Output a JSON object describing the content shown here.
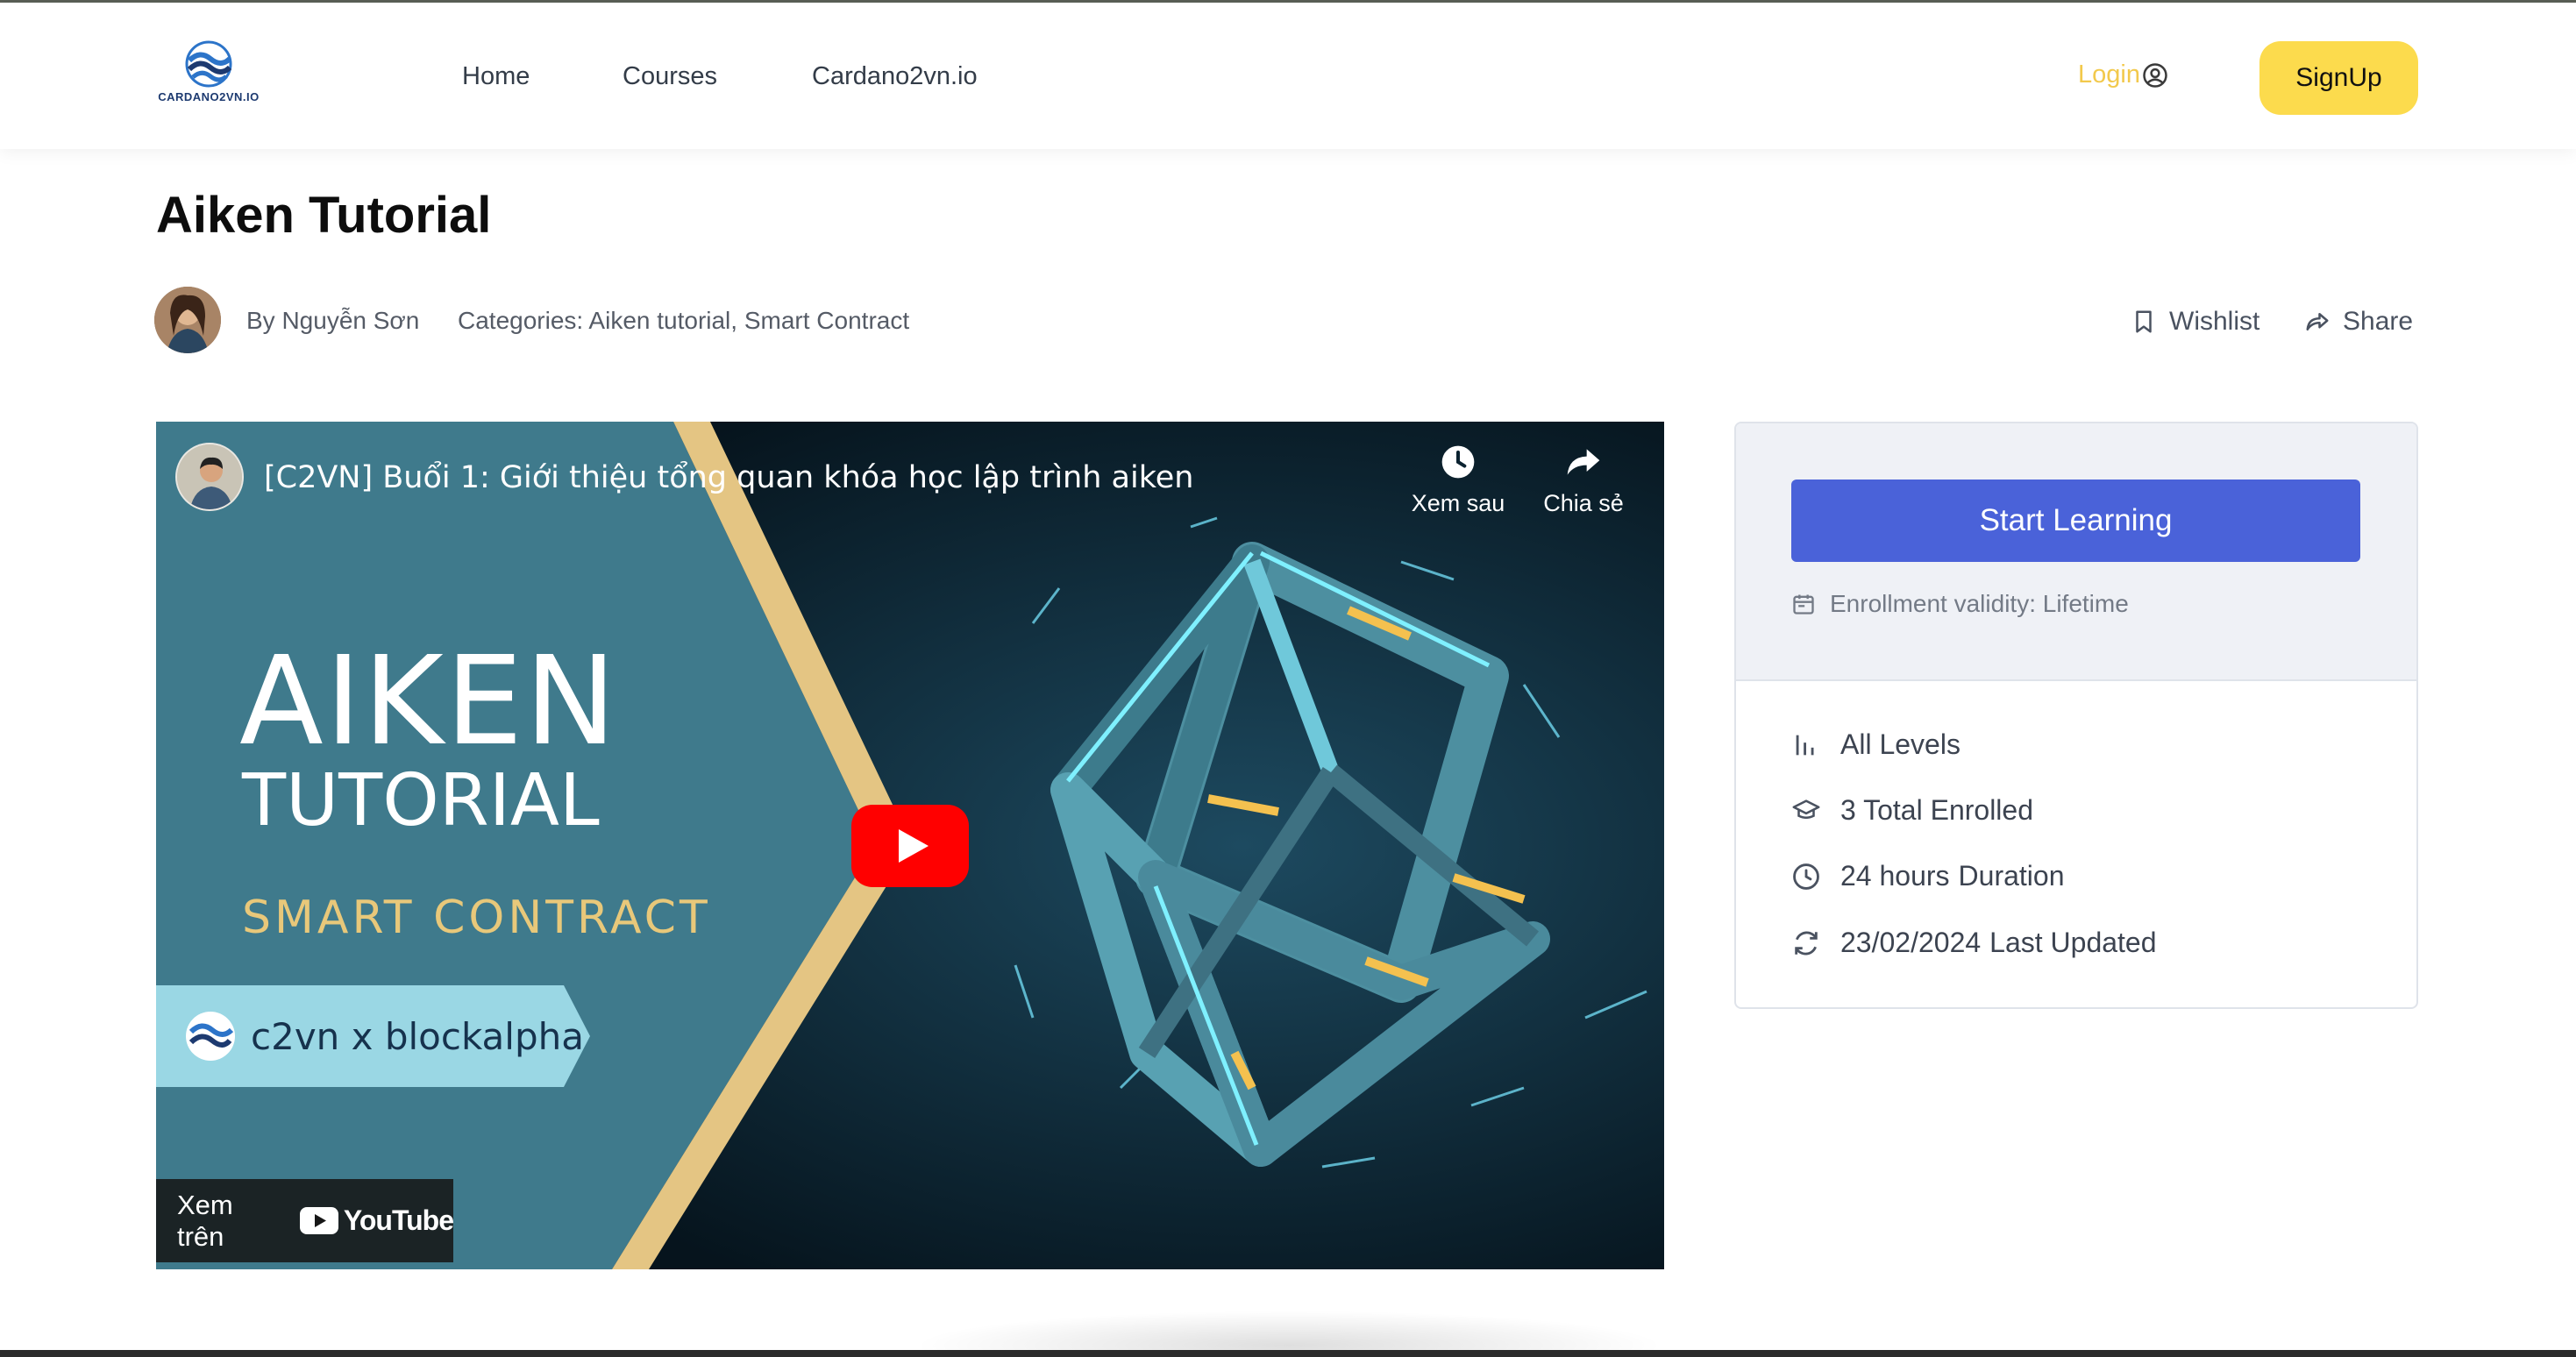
{
  "header": {
    "logo_text": "CARDANO2VN.IO",
    "nav": [
      {
        "label": "Home"
      },
      {
        "label": "Courses"
      },
      {
        "label": "Cardano2vn.io"
      }
    ],
    "login_label": "Login",
    "signup_label": "SignUp"
  },
  "course": {
    "title": "Aiken Tutorial",
    "author": "By Nguyễn Sơn",
    "categories": "Categories: Aiken tutorial, Smart Contract",
    "wishlist_label": "Wishlist",
    "share_label": "Share"
  },
  "video": {
    "title": "[C2VN] Buổi 1: Giới thiệu tổng quan khóa học lập trình aiken",
    "watch_later_label": "Xem sau",
    "share_label": "Chia sẻ",
    "thumbnail": {
      "line1": "AIKEN",
      "line2": "TUTORIAL",
      "line3": "SMART CONTRACT",
      "badge": "c2vn x blockalpha"
    },
    "watch_on_label": "Xem trên",
    "youtube_label": "YouTube"
  },
  "sidebar": {
    "start_label": "Start Learning",
    "validity": "Enrollment validity: Lifetime",
    "levels": "All Levels",
    "enrolled": "3 Total Enrolled",
    "duration_value": "24 hours",
    "duration_label": "Duration",
    "updated_value": "23/02/2024",
    "updated_label": "Last Updated"
  },
  "colors": {
    "accent_yellow": "#fcdb4d",
    "login_yellow": "#f2c94c",
    "primary_blue": "#4a62d9",
    "youtube_red": "#ff0000"
  },
  "icons": [
    "user-circle-icon",
    "bookmark-icon",
    "share-arrow-icon",
    "clock-icon",
    "calendar-icon",
    "bar-levels-icon",
    "graduation-cap-icon",
    "refresh-icon",
    "play-icon"
  ]
}
